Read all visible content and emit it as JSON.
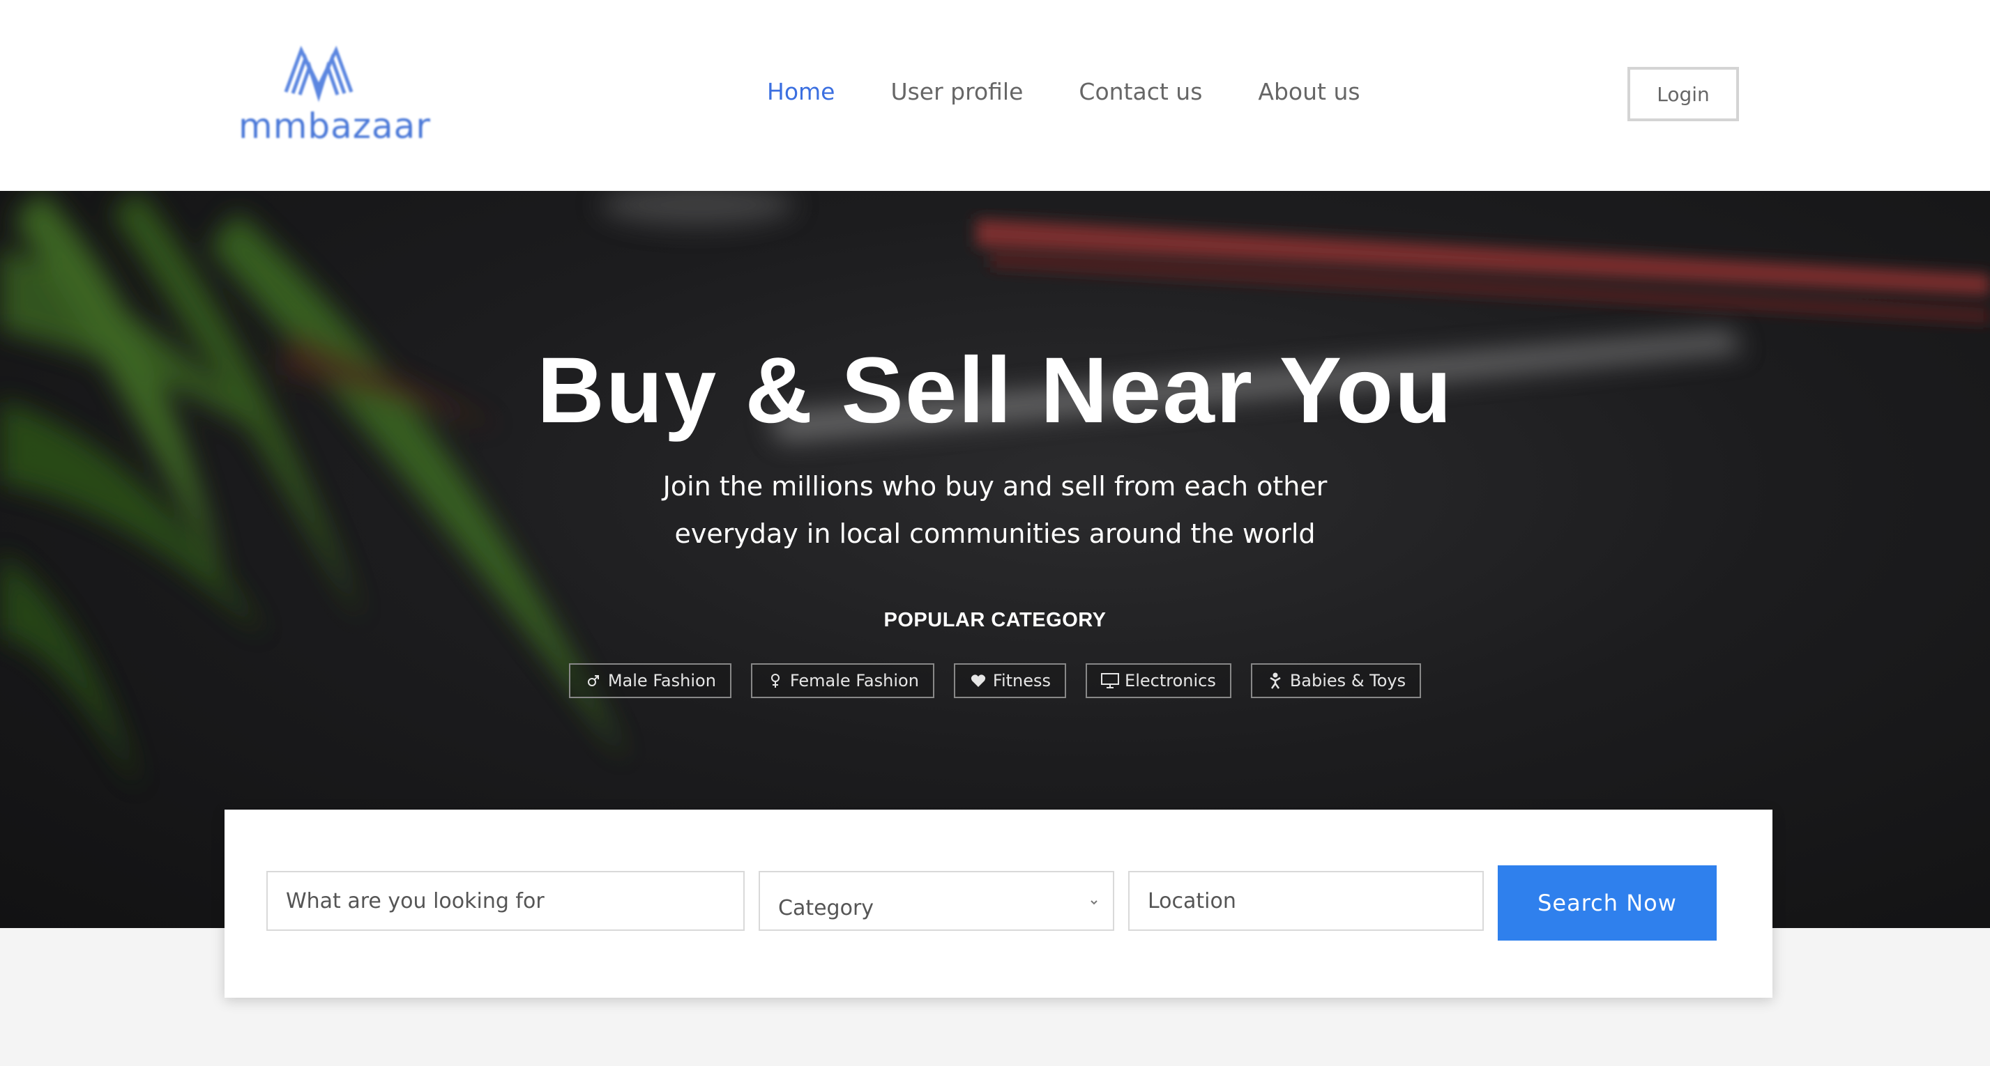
{
  "brand": {
    "name": "mmbazaar",
    "color": "#4a78d8"
  },
  "nav": {
    "items": [
      {
        "label": "Home",
        "active": true
      },
      {
        "label": "User profile",
        "active": false
      },
      {
        "label": "Contact us",
        "active": false
      },
      {
        "label": "About us",
        "active": false
      }
    ],
    "login_label": "Login"
  },
  "hero": {
    "title": "Buy & Sell Near You",
    "subtitle_line1": "Join the millions who buy and sell from each other",
    "subtitle_line2": "everyday in local communities around the world",
    "popular_title": "POPULAR CATEGORY",
    "categories": [
      {
        "label": "Male Fashion",
        "icon": "male-icon"
      },
      {
        "label": "Female Fashion",
        "icon": "female-icon"
      },
      {
        "label": "Fitness",
        "icon": "heart-icon"
      },
      {
        "label": "Electronics",
        "icon": "monitor-icon"
      },
      {
        "label": "Babies & Toys",
        "icon": "baby-icon"
      }
    ]
  },
  "search": {
    "keyword_placeholder": "What are you looking for",
    "category_selected": "Category",
    "location_placeholder": "Location",
    "button_label": "Search Now",
    "button_color": "#2f80ed"
  }
}
